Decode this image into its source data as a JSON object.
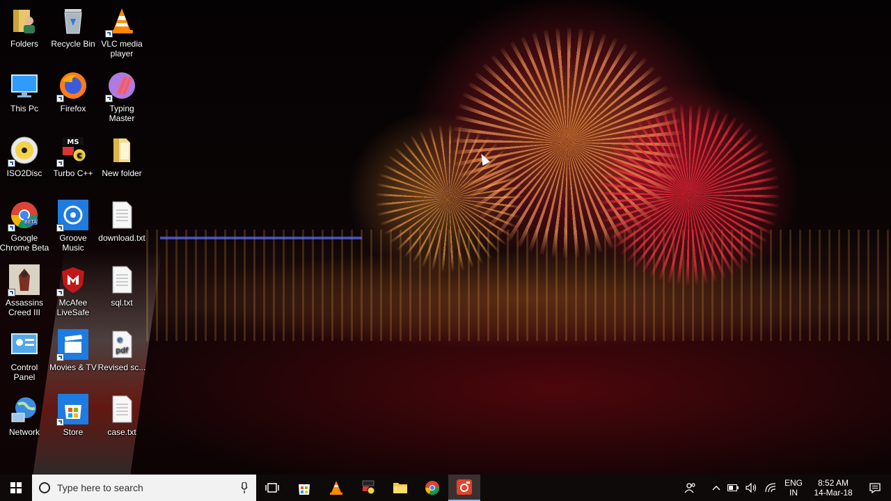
{
  "desktop_icons": [
    {
      "id": "folders",
      "label": "Folders",
      "icon": "user-folder-icon"
    },
    {
      "id": "recycle-bin",
      "label": "Recycle Bin",
      "icon": "recycle-bin-icon"
    },
    {
      "id": "vlc",
      "label": "VLC media player",
      "icon": "vlc-cone-icon"
    },
    {
      "id": "this-pc",
      "label": "This Pc",
      "icon": "monitor-icon"
    },
    {
      "id": "firefox",
      "label": "Firefox",
      "icon": "firefox-icon"
    },
    {
      "id": "typing-master",
      "label": "Typing Master",
      "icon": "typing-master-icon"
    },
    {
      "id": "iso2disc",
      "label": "ISO2Disc",
      "icon": "disc-icon"
    },
    {
      "id": "turbo-cpp",
      "label": "Turbo C++",
      "icon": "turbo-cpp-icon"
    },
    {
      "id": "new-folder",
      "label": "New folder",
      "icon": "folder-icon"
    },
    {
      "id": "chrome-beta",
      "label": "Google Chrome Beta",
      "icon": "chrome-beta-icon"
    },
    {
      "id": "groove-music",
      "label": "Groove Music",
      "icon": "groove-music-icon"
    },
    {
      "id": "download-txt",
      "label": "download.txt",
      "icon": "text-file-icon"
    },
    {
      "id": "assassins-creed",
      "label": "Assassins Creed III",
      "icon": "assassins-creed-icon"
    },
    {
      "id": "mcafee",
      "label": "McAfee LiveSafe",
      "icon": "mcafee-shield-icon"
    },
    {
      "id": "sql-txt",
      "label": "sql.txt",
      "icon": "text-file-icon"
    },
    {
      "id": "control-panel",
      "label": "Control Panel",
      "icon": "control-panel-icon"
    },
    {
      "id": "movies-tv",
      "label": "Movies & TV",
      "icon": "clapperboard-icon"
    },
    {
      "id": "revised-pdf",
      "label": "Revised sc...",
      "icon": "pdf-file-icon"
    },
    {
      "id": "network",
      "label": "Network",
      "icon": "globe-network-icon"
    },
    {
      "id": "store",
      "label": "Store",
      "icon": "store-bag-icon"
    },
    {
      "id": "case-txt",
      "label": "case.txt",
      "icon": "text-file-icon"
    }
  ],
  "taskbar": {
    "search_placeholder": "Type here to search",
    "pinned": [
      {
        "id": "task-view",
        "icon": "task-view-icon"
      },
      {
        "id": "store",
        "icon": "store-bag-icon"
      },
      {
        "id": "vlc",
        "icon": "vlc-cone-icon"
      },
      {
        "id": "turbo-cpp",
        "icon": "turbo-cpp-icon"
      },
      {
        "id": "file-explorer",
        "icon": "folder-icon"
      },
      {
        "id": "chrome",
        "icon": "chrome-beta-icon"
      },
      {
        "id": "recorder",
        "icon": "screen-recorder-icon",
        "active": true
      }
    ],
    "tray": {
      "lang_top": "ENG",
      "lang_bottom": "IN",
      "time": "8:52 AM",
      "date": "14-Mar-18"
    }
  },
  "colors": {
    "taskbar_bg": "#0f0a0a",
    "search_bg": "#f2f2f2",
    "active_accent": "#8ab4f8",
    "recorder_red": "#e0452b"
  }
}
